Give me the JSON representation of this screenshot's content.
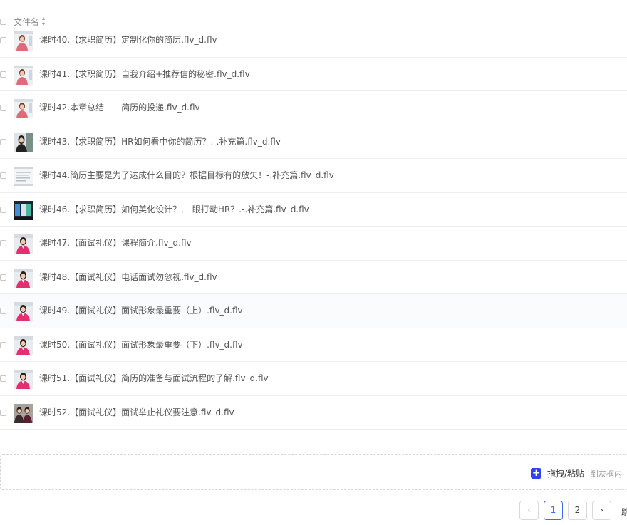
{
  "header": {
    "column_label": "文件名",
    "sort_icon": "sort-icon"
  },
  "files": [
    {
      "name": "课时40.【求职简历】定制化你的简历.flv_d.flv",
      "thumb": "presenter-white"
    },
    {
      "name": "课时41.【求职简历】自我介绍+推荐信的秘密.flv_d.flv",
      "thumb": "presenter-white"
    },
    {
      "name": "课时42.本章总结——简历的投递.flv_d.flv",
      "thumb": "presenter-white"
    },
    {
      "name": "课时43.【求职简历】HR如何看中你的简历？.-.补充篇.flv_d.flv",
      "thumb": "presenter-dark"
    },
    {
      "name": "课时44.简历主要是为了达成什么目的？根据目标有的放矢！-.补充篇.flv_d.flv",
      "thumb": "slide-text"
    },
    {
      "name": "课时46.【求职简历】如何美化设计？.一眼打动HR？.-.补充篇.flv_d.flv",
      "thumb": "slide-dark"
    },
    {
      "name": "课时47.【面试礼仪】课程简介.flv_d.flv",
      "thumb": "presenter-pink"
    },
    {
      "name": "课时48.【面试礼仪】电话面试勿忽视.flv_d.flv",
      "thumb": "presenter-pink"
    },
    {
      "name": "课时49.【面试礼仪】面试形象最重要（上）.flv_d.flv",
      "thumb": "presenter-pink"
    },
    {
      "name": "课时50.【面试礼仪】面试形象最重要（下）.flv_d.flv",
      "thumb": "presenter-pink"
    },
    {
      "name": "课时51.【面试礼仪】简历的准备与面试流程的了解.flv_d.flv",
      "thumb": "presenter-pink"
    },
    {
      "name": "课时52.【面试礼仪】面试举止礼仪要注意.flv_d.flv",
      "thumb": "presenter-two"
    }
  ],
  "dropzone": {
    "main_label": "拖拽/粘贴",
    "hint": "到灰框内",
    "icon": "plus-icon",
    "accent": "#2f45e8"
  },
  "pagination": {
    "prev_icon": "chevron-left-icon",
    "pages": [
      "1",
      "2"
    ],
    "current": "1",
    "next_icon": "chevron-right-icon",
    "jump_label": "跳",
    "accent": "#3b6cf0"
  }
}
